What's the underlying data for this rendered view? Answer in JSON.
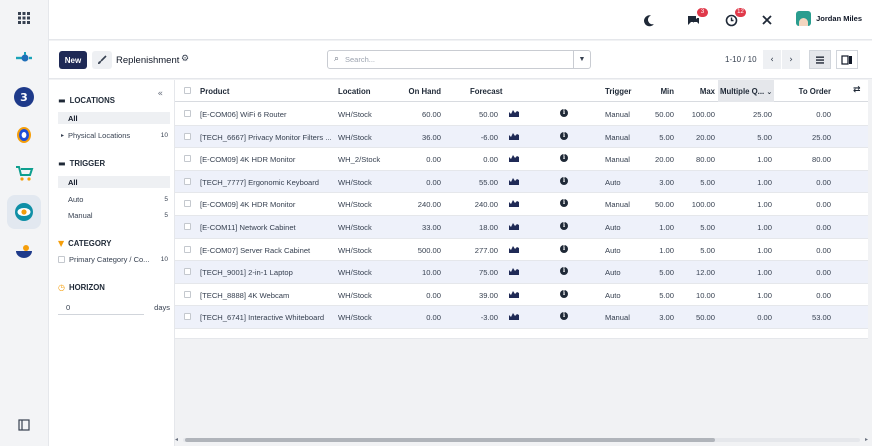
{
  "colors": {
    "primary": "#1f2a56",
    "badge": "#e0394a",
    "row_alt": "#eef1fa"
  },
  "rail": {
    "icons": [
      "apps-grid-icon",
      "connector-app-icon",
      "3-app-icon",
      "drop-app-icon",
      "cart-app-icon",
      "eye-app-icon",
      "bowl-app-icon",
      "sidebar-toggle-icon"
    ]
  },
  "topbar": {
    "chat_badge": "3",
    "activity_badge": "12",
    "user_name": "Jordan Miles"
  },
  "control": {
    "new_label": "New",
    "title": "Replenishment",
    "search_placeholder": "Search...",
    "pager": "1-10 / 10"
  },
  "filters": {
    "locations": {
      "heading": "LOCATIONS",
      "all": "All",
      "items": [
        {
          "label": "Physical Locations",
          "count": "10"
        }
      ]
    },
    "trigger": {
      "heading": "TRIGGER",
      "all": "All",
      "items": [
        {
          "label": "Auto",
          "count": "5"
        },
        {
          "label": "Manual",
          "count": "5"
        }
      ]
    },
    "category": {
      "heading": "CATEGORY",
      "items": [
        {
          "label": "Primary Category / Co...",
          "count": "10"
        }
      ]
    },
    "horizon": {
      "heading": "HORIZON",
      "value": "0",
      "unit": "days"
    }
  },
  "table": {
    "headers": {
      "product": "Product",
      "location": "Location",
      "on_hand": "On Hand",
      "forecast": "Forecast",
      "trigger": "Trigger",
      "min": "Min",
      "max": "Max",
      "multiple": "Multiple Q...",
      "to_order": "To Order"
    },
    "rows": [
      {
        "product": "[E-COM06] WiFi 6 Router",
        "location": "WH/Stock",
        "on_hand": "60.00",
        "forecast": "50.00",
        "trigger": "Manual",
        "min": "50.00",
        "max": "100.00",
        "multiple": "25.00",
        "to_order": "0.00"
      },
      {
        "product": "[TECH_6667] Privacy Monitor Filters ...",
        "location": "WH/Stock",
        "on_hand": "36.00",
        "forecast": "-6.00",
        "trigger": "Manual",
        "min": "5.00",
        "max": "20.00",
        "multiple": "5.00",
        "to_order": "25.00"
      },
      {
        "product": "[E-COM09] 4K HDR Monitor",
        "location": "WH_2/Stock",
        "on_hand": "0.00",
        "forecast": "0.00",
        "trigger": "Manual",
        "min": "20.00",
        "max": "80.00",
        "multiple": "1.00",
        "to_order": "80.00"
      },
      {
        "product": "[TECH_7777] Ergonomic Keyboard",
        "location": "WH/Stock",
        "on_hand": "0.00",
        "forecast": "55.00",
        "trigger": "Auto",
        "min": "3.00",
        "max": "5.00",
        "multiple": "1.00",
        "to_order": "0.00"
      },
      {
        "product": "[E-COM09] 4K HDR Monitor",
        "location": "WH/Stock",
        "on_hand": "240.00",
        "forecast": "240.00",
        "trigger": "Manual",
        "min": "50.00",
        "max": "100.00",
        "multiple": "1.00",
        "to_order": "0.00"
      },
      {
        "product": "[E-COM11] Network Cabinet",
        "location": "WH/Stock",
        "on_hand": "33.00",
        "forecast": "18.00",
        "trigger": "Auto",
        "min": "1.00",
        "max": "5.00",
        "multiple": "1.00",
        "to_order": "0.00"
      },
      {
        "product": "[E-COM07] Server Rack Cabinet",
        "location": "WH/Stock",
        "on_hand": "500.00",
        "forecast": "277.00",
        "trigger": "Auto",
        "min": "1.00",
        "max": "5.00",
        "multiple": "1.00",
        "to_order": "0.00"
      },
      {
        "product": "[TECH_9001] 2-in-1 Laptop",
        "location": "WH/Stock",
        "on_hand": "10.00",
        "forecast": "75.00",
        "trigger": "Auto",
        "min": "5.00",
        "max": "12.00",
        "multiple": "1.00",
        "to_order": "0.00"
      },
      {
        "product": "[TECH_8888] 4K Webcam",
        "location": "WH/Stock",
        "on_hand": "0.00",
        "forecast": "39.00",
        "trigger": "Auto",
        "min": "5.00",
        "max": "10.00",
        "multiple": "1.00",
        "to_order": "0.00"
      },
      {
        "product": "[TECH_6741] Interactive Whiteboard",
        "location": "WH/Stock",
        "on_hand": "0.00",
        "forecast": "-3.00",
        "trigger": "Manual",
        "min": "3.00",
        "max": "50.00",
        "multiple": "0.00",
        "to_order": "53.00"
      }
    ]
  }
}
